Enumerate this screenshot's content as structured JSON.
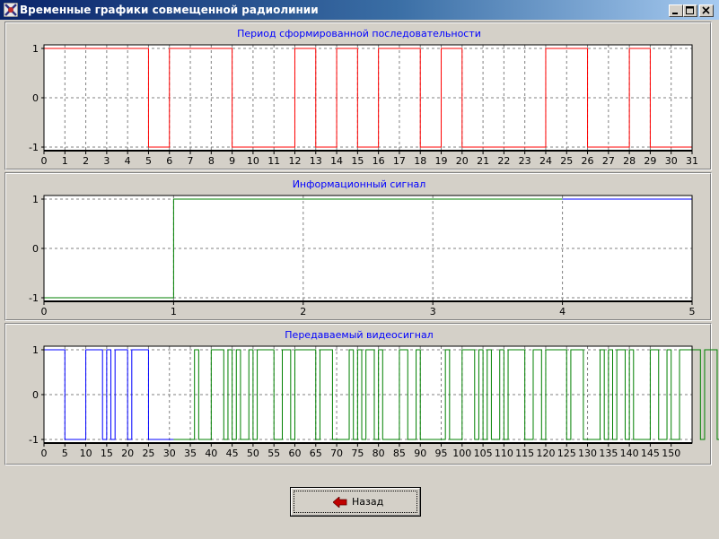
{
  "window": {
    "title": "Временные графики совмещенной радиолинии",
    "controls": [
      "minimize",
      "maximize",
      "close"
    ]
  },
  "colors": {
    "title_text": "#0000ff",
    "seq_line": "#ff0000",
    "info_line": "#008000",
    "info_line_tail": "#0000ff",
    "video_line_a": "#0000ff",
    "video_line_b": "#008000",
    "grid": "#808080"
  },
  "chart_data": [
    {
      "type": "line",
      "step": true,
      "title": "Период сформированной последовательности",
      "xlim": [
        0,
        31
      ],
      "ylim": [
        -1,
        1
      ],
      "x_ticks": [
        0,
        1,
        2,
        3,
        4,
        5,
        6,
        7,
        8,
        9,
        10,
        11,
        12,
        13,
        14,
        15,
        16,
        17,
        18,
        19,
        20,
        21,
        22,
        23,
        24,
        25,
        26,
        27,
        28,
        29,
        30,
        31
      ],
      "y_ticks": [
        -1,
        0,
        1
      ],
      "grid": true,
      "series": [
        {
          "color": "#ff0000",
          "values": [
            1,
            1,
            1,
            1,
            1,
            -1,
            1,
            1,
            1,
            -1,
            -1,
            -1,
            1,
            -1,
            1,
            -1,
            1,
            1,
            -1,
            1,
            -1,
            -1,
            -1,
            -1,
            1,
            1,
            -1,
            -1,
            1,
            -1,
            -1
          ]
        }
      ]
    },
    {
      "type": "line",
      "step": true,
      "title": "Информационный сигнал",
      "xlim": [
        0,
        5
      ],
      "ylim": [
        -1,
        1
      ],
      "x_ticks": [
        0,
        1,
        2,
        3,
        4,
        5
      ],
      "y_ticks": [
        -1,
        0,
        1
      ],
      "grid": true,
      "series": [
        {
          "color": "#008000",
          "values": [
            -1,
            1,
            1,
            1
          ]
        },
        {
          "color": "#0000ff",
          "values": [
            1
          ]
        }
      ]
    },
    {
      "type": "line",
      "step": true,
      "title": "Передаваемый видеосигнал",
      "xlim": [
        0,
        155
      ],
      "ylim": [
        -1,
        1
      ],
      "x_ticks": [
        0,
        5,
        10,
        15,
        20,
        25,
        30,
        35,
        40,
        45,
        50,
        55,
        60,
        65,
        70,
        75,
        80,
        85,
        90,
        95,
        100,
        105,
        110,
        115,
        120,
        125,
        130,
        135,
        140,
        145,
        150
      ],
      "y_ticks": [
        -1,
        0,
        1
      ],
      "grid": true,
      "series": [
        {
          "color": "#0000ff",
          "values": [
            1,
            1,
            1,
            1,
            1,
            -1,
            -1,
            -1,
            -1,
            -1,
            1,
            1,
            1,
            1,
            -1,
            1,
            -1,
            1,
            1,
            1,
            -1,
            1,
            1,
            1,
            1,
            -1,
            -1,
            -1,
            -1,
            -1,
            -1
          ]
        },
        {
          "color": "#008000",
          "values": [
            -1,
            -1,
            -1,
            -1,
            -1,
            1,
            -1,
            -1,
            -1,
            1,
            1,
            1,
            -1,
            1,
            -1,
            1,
            -1,
            -1,
            1,
            -1,
            1,
            1,
            1,
            1,
            -1,
            -1,
            1,
            1,
            -1,
            1,
            1,
            1,
            1,
            1,
            -1,
            1,
            1,
            1,
            -1,
            -1,
            -1,
            -1,
            1,
            -1,
            1,
            -1,
            1,
            1,
            -1,
            1,
            -1,
            -1,
            -1,
            -1,
            1,
            1,
            -1,
            -1,
            1,
            -1,
            -1,
            -1,
            -1,
            -1,
            -1,
            1,
            -1,
            -1,
            -1,
            1,
            1,
            1,
            -1,
            1,
            -1,
            1,
            -1,
            -1,
            1,
            -1,
            1,
            1,
            1,
            1,
            -1,
            -1,
            1,
            1,
            -1,
            1,
            1,
            1,
            1,
            1,
            -1,
            1,
            1,
            1,
            -1,
            -1,
            -1,
            -1,
            1,
            -1,
            1,
            -1,
            1,
            1,
            -1,
            1,
            -1,
            -1,
            -1,
            -1,
            1,
            1,
            -1,
            -1,
            1,
            -1,
            -1,
            1,
            1,
            1,
            1,
            1,
            -1,
            1,
            1,
            1,
            -1
          ]
        }
      ]
    }
  ],
  "back_button": {
    "label": "Назад",
    "icon": "arrow-left-icon"
  }
}
